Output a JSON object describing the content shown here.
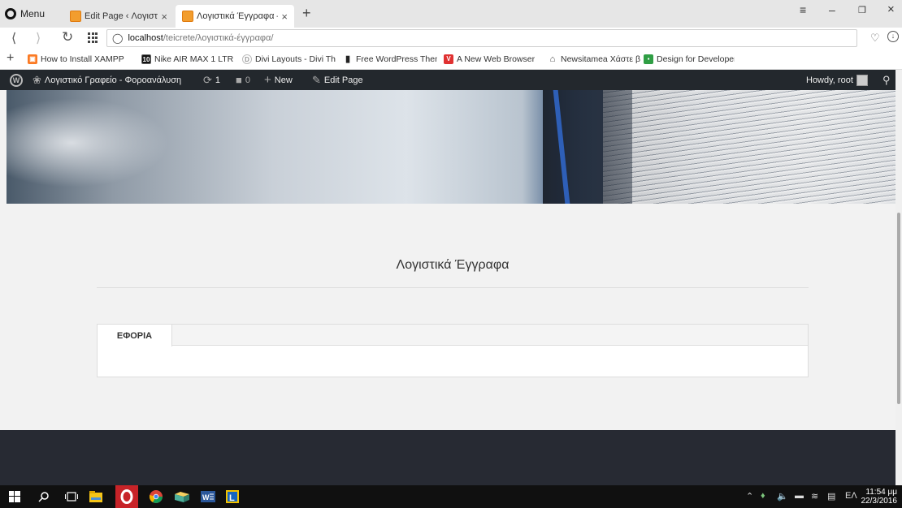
{
  "browser": {
    "menu_label": "Menu",
    "tabs": [
      {
        "label": "Edit Page ‹ Λογιστικό Γραφ",
        "close": "×"
      },
      {
        "label": "Λογιστικά Έγγραφα – Λογ",
        "close": "×"
      }
    ],
    "new_tab": "+",
    "url_host": "localhost",
    "url_path": "/teicrete/λογιστικά-έγγραφα/",
    "window": {
      "minimize": "–",
      "restore": "❐",
      "close": "×",
      "menu": "≡"
    }
  },
  "bookmarks": [
    {
      "label": "How to Install XAMPP",
      "icon": "xampp-icon",
      "color": "#fb7a24",
      "glyph": "▣"
    },
    {
      "label": "Nike AIR MAX 1 LTR",
      "icon": "nike-icon",
      "color": "#111111",
      "glyph": "10"
    },
    {
      "label": "Divi Layouts - Divi Th",
      "icon": "divi-icon",
      "color": "#bbbbbb",
      "glyph": "D"
    },
    {
      "label": "Free WordPress Then",
      "icon": "document-icon",
      "color": "#222222",
      "glyph": "▮"
    },
    {
      "label": "A New Web Browser",
      "icon": "vivaldi-icon",
      "color": "#e03131",
      "glyph": "V"
    },
    {
      "label": "Newsitamea Χάστε β",
      "icon": "news-icon",
      "color": "#444444",
      "glyph": "⌂"
    },
    {
      "label": "Design for Developer",
      "icon": "design-icon",
      "color": "#2f9e44",
      "glyph": "▪"
    }
  ],
  "adminbar": {
    "site_name": "Λογιστικό Γραφείο - Φοροανάλυση",
    "updates_count": "1",
    "comments_count": "0",
    "new_label": "New",
    "edit_label": "Edit Page",
    "howdy": "Howdy, root"
  },
  "page": {
    "title": "Λογιστικά Έγγραφα",
    "tabs": [
      {
        "label": "ΕΦΟΡΙΑ"
      }
    ]
  },
  "taskbar": {
    "lang": "ΕΛ",
    "time": "11:54 μμ",
    "date": "22/3/2016"
  }
}
